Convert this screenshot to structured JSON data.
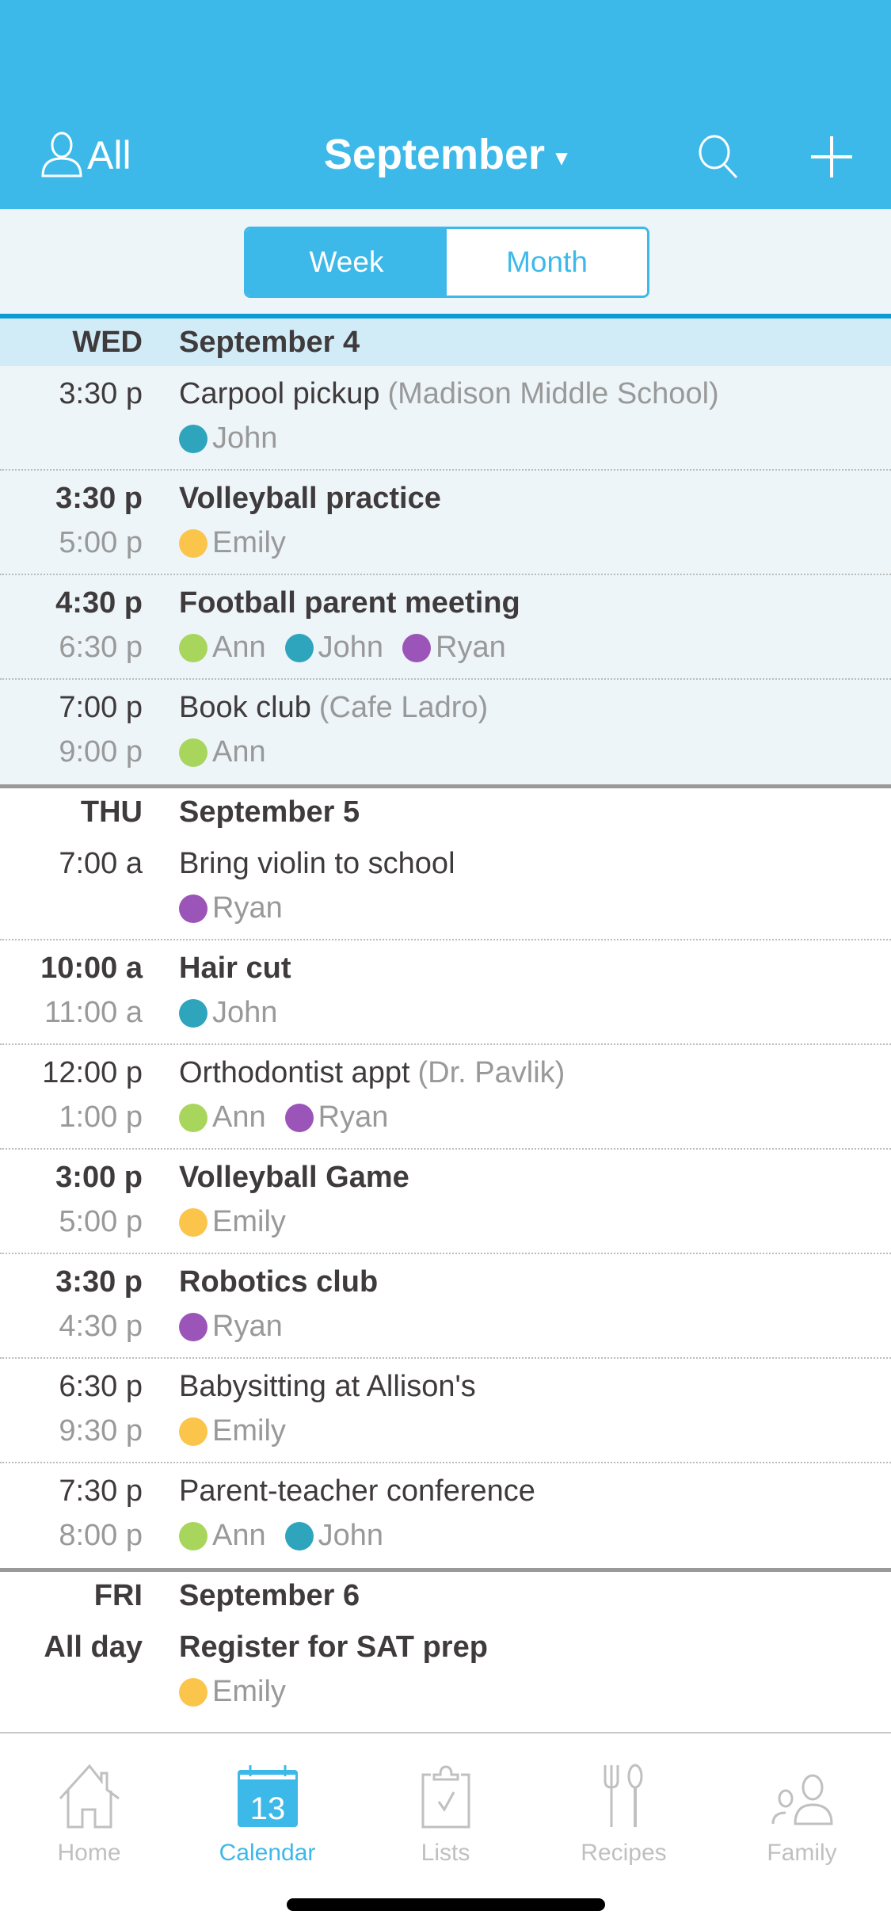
{
  "header": {
    "filter_label": "All",
    "title": "September",
    "caret": "▾"
  },
  "view_toggle": {
    "week": "Week",
    "month": "Month",
    "selected": "Week"
  },
  "colors": {
    "accent": "#3db9e9",
    "Ann": "#a8d65d",
    "John": "#2ea5bd",
    "Ryan": "#9b55b8",
    "Emily": "#fbc54c"
  },
  "days": [
    {
      "dow": "WED",
      "date": "September 4",
      "events": [
        {
          "start": "3:30 p",
          "end": "",
          "title": "Carpool pickup",
          "location": "(Madison Middle School)",
          "bold": false,
          "people": [
            "John"
          ]
        },
        {
          "start": "3:30 p",
          "end": "5:00 p",
          "title": "Volleyball practice",
          "location": "",
          "bold": true,
          "people": [
            "Emily"
          ]
        },
        {
          "start": "4:30 p",
          "end": "6:30 p",
          "title": "Football parent meeting",
          "location": "",
          "bold": true,
          "people": [
            "Ann",
            "John",
            "Ryan"
          ]
        },
        {
          "start": "7:00 p",
          "end": "9:00 p",
          "title": "Book club",
          "location": "(Cafe Ladro)",
          "bold": false,
          "people": [
            "Ann"
          ]
        }
      ]
    },
    {
      "dow": "THU",
      "date": "September 5",
      "events": [
        {
          "start": "7:00 a",
          "end": "",
          "title": "Bring violin to school",
          "location": "",
          "bold": false,
          "people": [
            "Ryan"
          ]
        },
        {
          "start": "10:00 a",
          "end": "11:00 a",
          "title": "Hair cut",
          "location": "",
          "bold": true,
          "people": [
            "John"
          ]
        },
        {
          "start": "12:00 p",
          "end": "1:00 p",
          "title": "Orthodontist appt",
          "location": "(Dr. Pavlik)",
          "bold": false,
          "people": [
            "Ann",
            "Ryan"
          ]
        },
        {
          "start": "3:00 p",
          "end": "5:00 p",
          "title": "Volleyball Game",
          "location": "",
          "bold": true,
          "people": [
            "Emily"
          ]
        },
        {
          "start": "3:30 p",
          "end": "4:30 p",
          "title": "Robotics club",
          "location": "",
          "bold": true,
          "people": [
            "Ryan"
          ]
        },
        {
          "start": "6:30 p",
          "end": "9:30 p",
          "title": "Babysitting at Allison's",
          "location": "",
          "bold": false,
          "people": [
            "Emily"
          ]
        },
        {
          "start": "7:30 p",
          "end": "8:00 p",
          "title": "Parent-teacher conference",
          "location": "",
          "bold": false,
          "people": [
            "Ann",
            "John"
          ]
        }
      ]
    },
    {
      "dow": "FRI",
      "date": "September 6",
      "events": [
        {
          "start": "All day",
          "end": "",
          "title": "Register for SAT prep",
          "location": "",
          "bold": true,
          "people": [
            "Emily"
          ]
        }
      ]
    }
  ],
  "tabbar": {
    "items": [
      {
        "label": "Home",
        "icon": "home-icon"
      },
      {
        "label": "Calendar",
        "icon": "calendar-icon",
        "badge": "13",
        "active": true
      },
      {
        "label": "Lists",
        "icon": "clipboard-icon"
      },
      {
        "label": "Recipes",
        "icon": "fork-spoon-icon"
      },
      {
        "label": "Family",
        "icon": "family-icon"
      }
    ]
  }
}
